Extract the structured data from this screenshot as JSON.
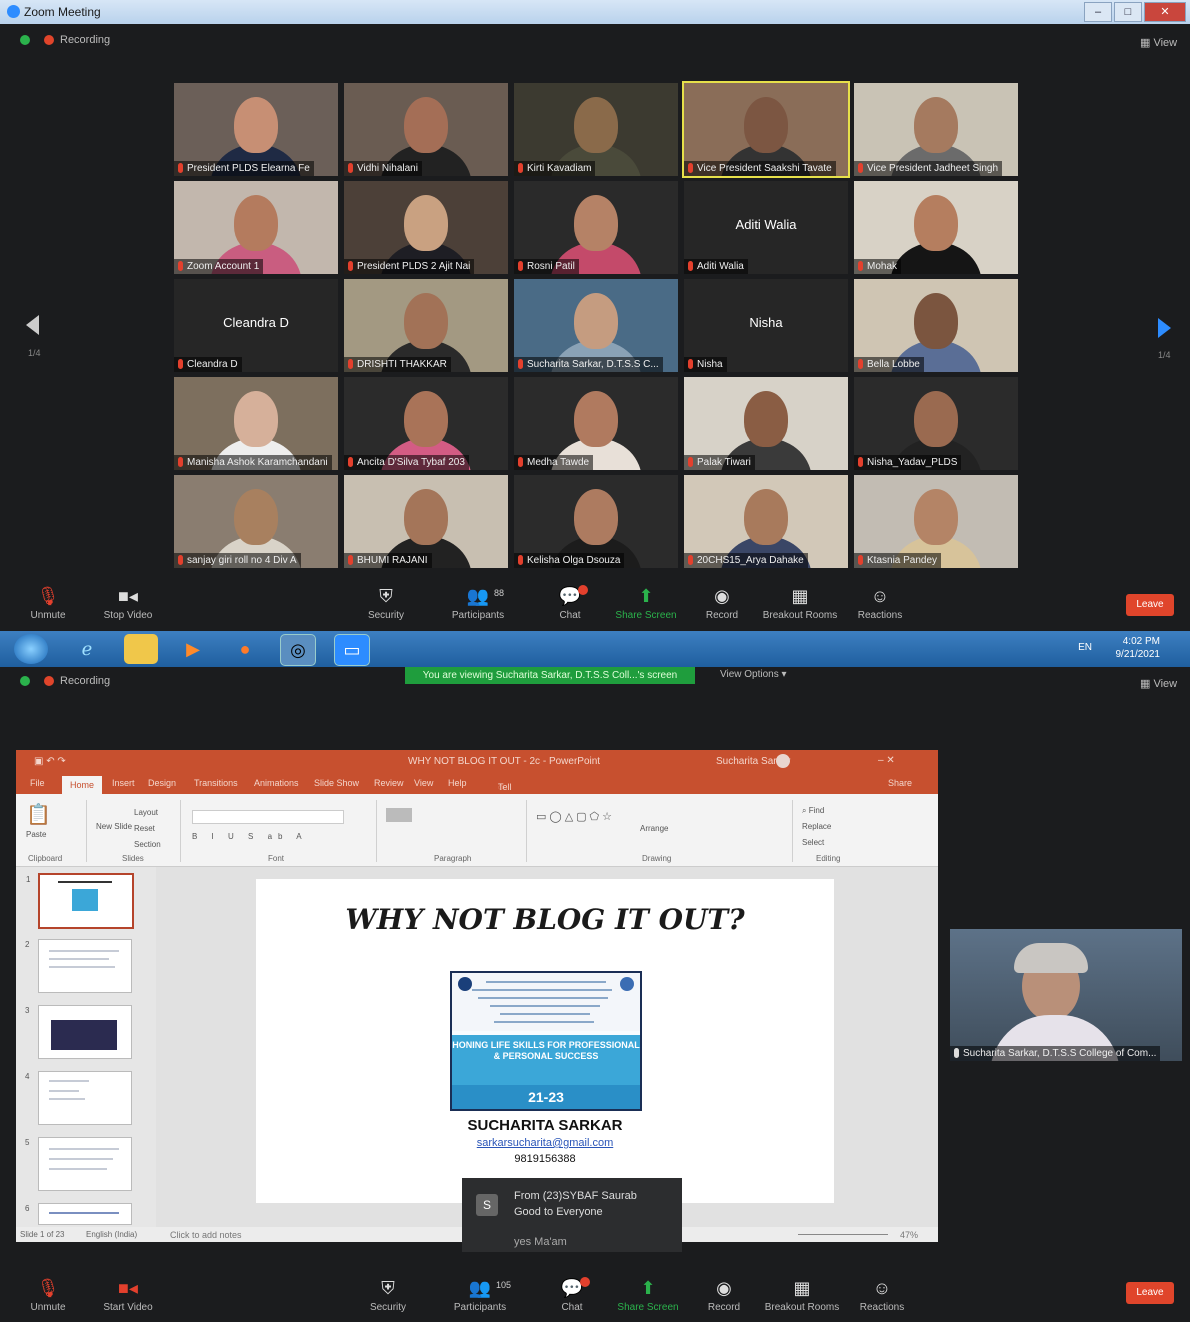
{
  "window": {
    "title": "Zoom Meeting",
    "min": "–",
    "max": "□",
    "close": "✕"
  },
  "recording": {
    "label": "Recording"
  },
  "view": {
    "label": "View"
  },
  "gallery": {
    "page_label": "1/4",
    "tiles": [
      {
        "name": "President PLDS Elearna Fe",
        "kind": "video",
        "bg": "#6b5f58",
        "skin": "#c78f74",
        "shirt": "#1f2a44"
      },
      {
        "name": "Vidhi Nihalani",
        "kind": "video",
        "bg": "#6a5c52",
        "skin": "#a46e56",
        "shirt": "#222"
      },
      {
        "name": "Kirti Kavadiam",
        "kind": "video",
        "bg": "#3c3a30",
        "skin": "#8a6a4a",
        "shirt": "#4a4a3a"
      },
      {
        "name": "Vice President Saakshi Tavate",
        "kind": "video",
        "bg": "#8a6d58",
        "skin": "#7c5642",
        "shirt": "#333",
        "active": true
      },
      {
        "name": "Vice President Jadheet Singh",
        "kind": "video",
        "bg": "#c9c3b5",
        "skin": "#a57a5f",
        "shirt": "#6b6b6b"
      },
      {
        "name": "Zoom Account 1",
        "kind": "video",
        "bg": "#c2b7ad",
        "skin": "#b47b5e",
        "shirt": "#c95d80"
      },
      {
        "name": "President PLDS 2 Ajit Nai",
        "kind": "video",
        "bg": "#4c4038",
        "skin": "#c9a181",
        "shirt": "#1e1e24"
      },
      {
        "name": "Rosni Patil",
        "kind": "video",
        "bg": "#2a2a2a",
        "skin": "#b58266",
        "shirt": "#c44a6a"
      },
      {
        "name": "Aditi Walia",
        "kind": "name",
        "center": "Aditi Walia"
      },
      {
        "name": "Mohak",
        "kind": "video",
        "bg": "#d8d2c6",
        "skin": "#b57e5f",
        "shirt": "#151515"
      },
      {
        "name": "Cleandra D",
        "kind": "name",
        "center": "Cleandra D"
      },
      {
        "name": "DRISHTI THAKKAR",
        "kind": "video",
        "bg": "#a39982",
        "skin": "#a27257",
        "shirt": "#2a2a2a"
      },
      {
        "name": "Sucharita Sarkar, D.T.S.S C...",
        "kind": "video",
        "bg": "#4a6b86",
        "skin": "#c59c80",
        "shirt": "#8aa2b6"
      },
      {
        "name": "Nisha",
        "kind": "name",
        "center": "Nisha"
      },
      {
        "name": "Bella Lobbe",
        "kind": "video",
        "bg": "#cfc5b3",
        "skin": "#7b553f",
        "shirt": "#5a6e96"
      },
      {
        "name": "Manisha Ashok Karamchandani",
        "kind": "video",
        "bg": "#7d6f5e",
        "skin": "#d6b09a",
        "shirt": "#eee"
      },
      {
        "name": "Ancita D'Silva Tybaf 203",
        "kind": "video",
        "bg": "#2b2b2b",
        "skin": "#a97358",
        "shirt": "#d35c84"
      },
      {
        "name": "Medha Tawde",
        "kind": "video",
        "bg": "#2b2b2b",
        "skin": "#b07a5f",
        "shirt": "#e8e0d8"
      },
      {
        "name": "Palak Tiwari",
        "kind": "video",
        "bg": "#d7d2c8",
        "skin": "#8a5d44",
        "shirt": "#3a3a3a"
      },
      {
        "name": "Nisha_Yadav_PLDS",
        "kind": "video",
        "bg": "#2b2b2b",
        "skin": "#9a6a50",
        "shirt": "#222"
      },
      {
        "name": "sanjay giri roll no 4 Div A",
        "kind": "video",
        "bg": "#8a7d70",
        "skin": "#a8805f",
        "shirt": "#d9d3c8"
      },
      {
        "name": "BHUMI RAJANI",
        "kind": "video",
        "bg": "#c8bfb1",
        "skin": "#a47559",
        "shirt": "#222"
      },
      {
        "name": "Kelisha Olga Dsouza",
        "kind": "video",
        "bg": "#2b2b2b",
        "skin": "#ad7b60",
        "shirt": "#1c1c1c"
      },
      {
        "name": "20CHS15_Arya Dahake",
        "kind": "video",
        "bg": "#d2c8b8",
        "skin": "#a87a5c",
        "shirt": "#3a4666"
      },
      {
        "name": "Ktasnia Pandey",
        "kind": "video",
        "bg": "#c2bcb3",
        "skin": "#b48466",
        "shirt": "#d7c39a"
      }
    ]
  },
  "toolbar_top": {
    "unmute": "Unmute",
    "stop_video": "Stop Video",
    "security": "Security",
    "participants": "Participants",
    "participants_count": "88",
    "chat": "Chat",
    "share_screen": "Share Screen",
    "record": "Record",
    "breakout": "Breakout Rooms",
    "reactions": "Reactions",
    "leave": "Leave"
  },
  "taskbar": {
    "lang": "EN",
    "time": "4:02 PM",
    "date": "9/21/2021"
  },
  "share": {
    "viewing": "You are viewing Sucharita Sarkar, D.T.S.S Coll...'s screen",
    "view_options": "View Options ▾"
  },
  "ppt": {
    "title": "WHY NOT BLOG IT OUT - 2c  -  PowerPoint",
    "user": "Sucharita Sarkar",
    "tabs": [
      "File",
      "Home",
      "Insert",
      "Design",
      "Transitions",
      "Animations",
      "Slide Show",
      "Review",
      "View",
      "Help"
    ],
    "tell_me": "Tell me what you want to do",
    "share": "Share",
    "ribbon_groups": [
      "Clipboard",
      "Slides",
      "Font",
      "Paragraph",
      "Drawing",
      "Editing"
    ],
    "ribbon_items": {
      "paste": "Paste",
      "new_slide": "New Slide",
      "layout": "Layout",
      "reset": "Reset",
      "section": "Section",
      "arrange": "Arrange",
      "find": "Find",
      "replace": "Replace",
      "select": "Select"
    },
    "slide_numbers": [
      "1",
      "2",
      "3",
      "4",
      "5",
      "6"
    ],
    "slide": {
      "heading": "WHY NOT BLOG IT OUT?",
      "poster_band": "HONING LIFE SKILLS FOR PROFESSIONAL & PERSONAL SUCCESS",
      "poster_dates": "21-23",
      "name": "SUCHARITA SARKAR",
      "email": "sarkarsucharita@gmail.com",
      "phone": "9819156388"
    },
    "notes": "Click to add notes",
    "status": "Slide 1 of 23",
    "status_lang": "English (India)",
    "zoom_pct": "47%"
  },
  "speaker_label": "Sucharita Sarkar, D.T.S.S College of Com...",
  "chat_popup": {
    "avatar": "S",
    "from": "From (23)SYBAF Saurab",
    "message": "Good to Everyone",
    "message2": "yes Ma'am"
  },
  "toolbar_bottom": {
    "unmute": "Unmute",
    "start_video": "Start Video",
    "security": "Security",
    "participants": "Participants",
    "participants_count": "105",
    "chat": "Chat",
    "share_screen": "Share Screen",
    "record": "Record",
    "breakout": "Breakout Rooms",
    "reactions": "Reactions",
    "leave": "Leave"
  }
}
